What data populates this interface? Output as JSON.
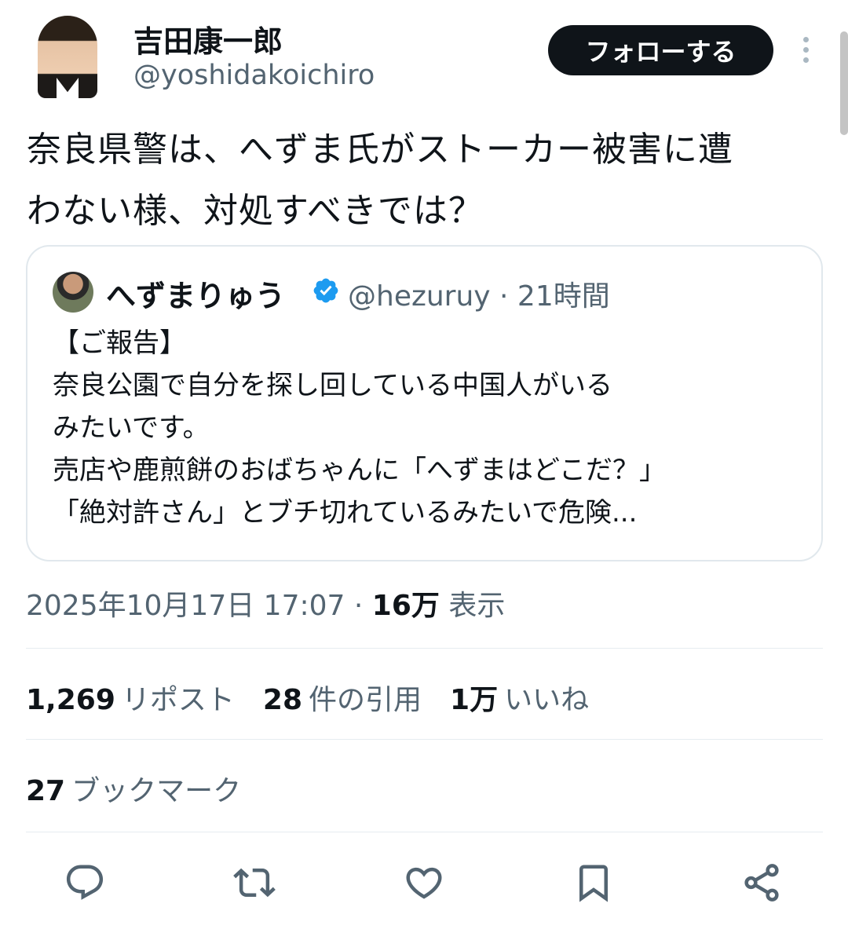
{
  "author": {
    "name": "吉田康一郎",
    "handle": "@yoshidakoichiro"
  },
  "follow_button": "フォローする",
  "tweet": {
    "lines": [
      "奈良県警は、へずま氏がストーカー被害に遭",
      "わない様、対処すべきでは？"
    ]
  },
  "quoted_tweet": {
    "name": "へずまりゅう",
    "handle_time": "@hezuruy · 21時間",
    "lines": [
      "【ご報告】",
      "奈良公園で自分を探し回している中国人がいる",
      "みたいです。",
      "売店や鹿煎餅のおばちゃんに「へずまはどこだ？」",
      "「絶対許さん」とブチ切れているみたいで危険..."
    ]
  },
  "meta": {
    "timestamp": "2025年10月17日 17:07 · ",
    "views_count": "16万",
    "views_label": " 表示"
  },
  "stats": {
    "reposts_count": "1,269",
    "reposts_label": "リポスト",
    "quotes_count": "28",
    "quotes_label": "件の引用",
    "likes_count": "1万",
    "likes_label": "いいね",
    "bookmarks_count": "27",
    "bookmarks_label": "ブックマーク"
  },
  "icons": {
    "reply": "reply-icon",
    "repost": "repost-icon",
    "like": "like-icon",
    "bookmark": "bookmark-icon",
    "share": "share-icon",
    "verified": "verified-badge-icon",
    "more": "more-options-icon"
  },
  "colors": {
    "text_primary": "#0f1419",
    "text_secondary": "#536471",
    "verified_blue": "#1d9bf0",
    "icon_gray": "#536471"
  }
}
